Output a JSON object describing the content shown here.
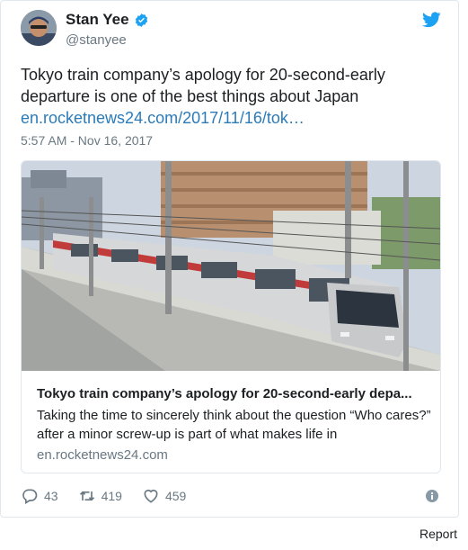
{
  "author": {
    "display_name": "Stan Yee",
    "handle": "@stanyee",
    "avatar": "avatar-photo",
    "verified_icon": "verified-badge-icon"
  },
  "brand_icon": "twitter-bird-icon",
  "tweet": {
    "text": "Tokyo train company’s apology for 20-second-early departure is one of the best things about Japan",
    "link": "en.rocketnews24.com/2017/11/16/tok…",
    "timestamp": "5:57 AM - Nov 16, 2017"
  },
  "card": {
    "image": "train-photo",
    "title": "Tokyo train company’s apology for 20-second-early depa...",
    "description": "Taking the time to sincerely think about the question “Who cares?” after a minor screw-up is part of what makes life in",
    "domain": "en.rocketnews24.com"
  },
  "actions": {
    "replies": "43",
    "retweets": "419",
    "likes": "459",
    "reply_icon": "reply-icon",
    "retweet_icon": "retweet-icon",
    "like_icon": "heart-icon",
    "info_icon": "info-icon"
  },
  "footer": {
    "report_label": "Report"
  },
  "colors": {
    "link": "#2b7bb9",
    "brand": "#1da1f2",
    "muted": "#697882",
    "border": "#e1e8ed"
  }
}
